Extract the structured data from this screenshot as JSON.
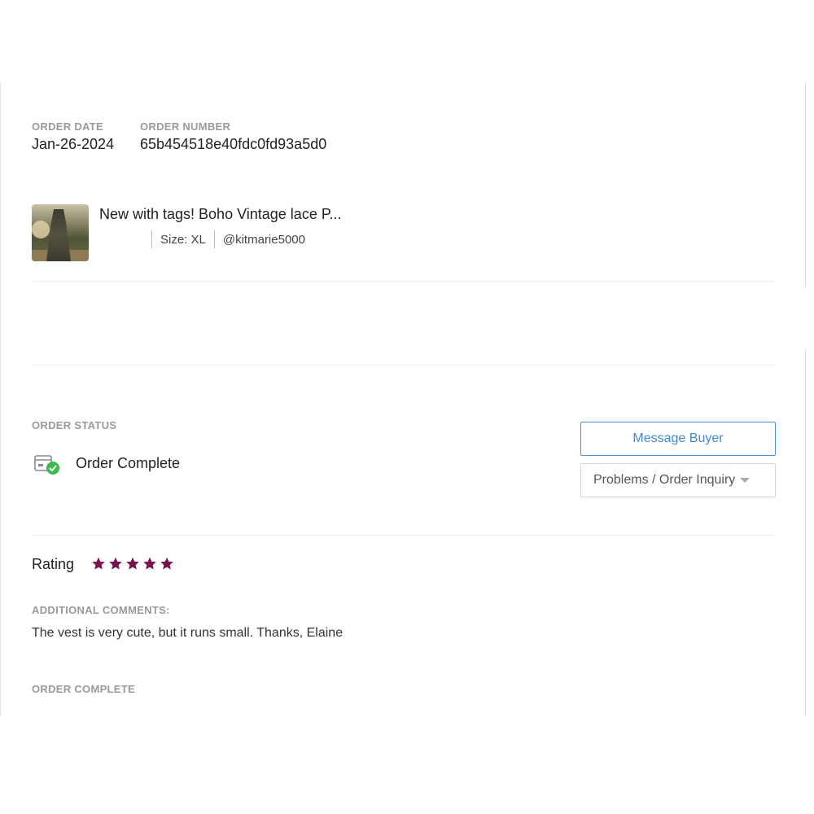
{
  "order": {
    "date_label": "ORDER DATE",
    "date_value": "Jan-26-2024",
    "number_label": "ORDER NUMBER",
    "number_value": "65b454518e40fdc0fd93a5d0"
  },
  "item": {
    "title": "New with tags! Boho Vintage lace P...",
    "size": "Size: XL",
    "seller": "@kitmarie5000",
    "image_alt": "Boho vintage lace vest photo"
  },
  "status": {
    "label": "ORDER STATUS",
    "value": "Order Complete",
    "icon": "package-check-icon",
    "icon_color": "#3dba4e"
  },
  "actions": {
    "message_buyer": "Message Buyer",
    "inquiry": "Problems / Order Inquiry"
  },
  "rating": {
    "label": "Rating",
    "stars": 5,
    "max_stars": 5,
    "star_color": "#7a1050"
  },
  "comments": {
    "label": "ADDITIONAL COMMENTS:",
    "text": "The vest is very cute, but it runs small. Thanks, Elaine"
  },
  "footer": {
    "label": "ORDER COMPLETE"
  },
  "colors": {
    "accent_blue": "#3f8ad0",
    "label_gray": "#9a9a9a"
  }
}
